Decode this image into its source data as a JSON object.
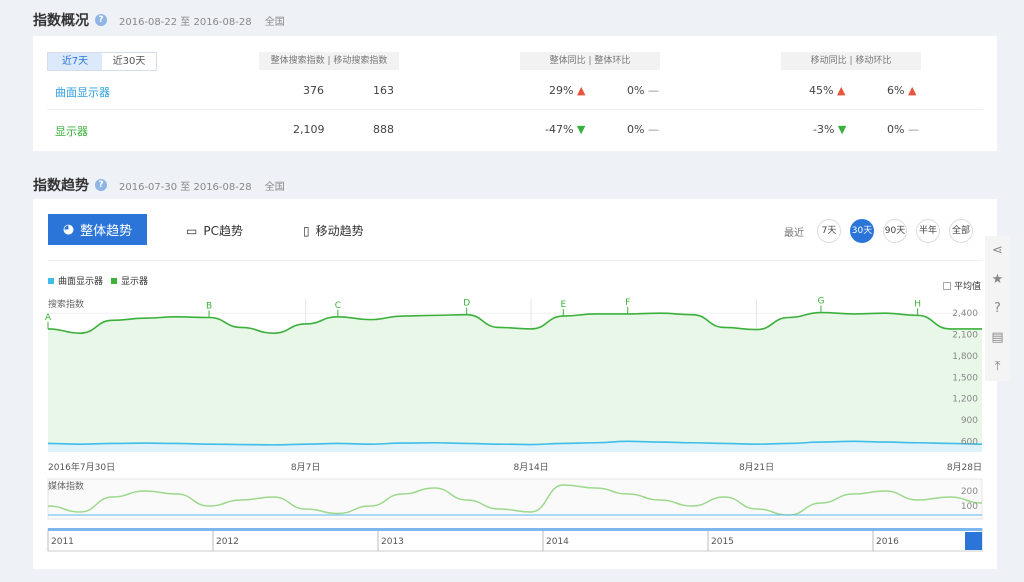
{
  "overview": {
    "title": "指数概况",
    "help": "?",
    "date_range": "2016-08-22 至 2016-08-28",
    "region": "全国",
    "tabs": [
      "近7天",
      "近30天"
    ],
    "headers": {
      "search": "整体搜索指数 | 移动搜索指数",
      "overall": "整体同比 | 整体环比",
      "mobile": "移动同比 | 移动环比"
    },
    "rows": [
      {
        "keyword": "曲面显示器",
        "total": "376",
        "mobile": "163",
        "overall_yoy": "29%",
        "overall_mom": "0%",
        "mobile_yoy": "45%",
        "mobile_mom": "6%"
      },
      {
        "keyword": "显示器",
        "total": "2,109",
        "mobile": "888",
        "overall_yoy": "-47%",
        "overall_mom": "0%",
        "mobile_yoy": "-3%",
        "mobile_mom": "0%"
      }
    ]
  },
  "trend": {
    "title": "指数趋势",
    "help": "?",
    "date_range": "2016-07-30 至 2016-08-28",
    "region": "全国",
    "tabs": [
      "整体趋势",
      "PC趋势",
      "移动趋势"
    ],
    "period_label": "最近",
    "periods": [
      "7天",
      "30天",
      "90天",
      "半年",
      "全部"
    ],
    "legend": [
      "曲面显示器",
      "显示器"
    ],
    "avg_label": "平均值",
    "search_label": "搜索指数",
    "media_label": "媒体指数",
    "y_ticks": [
      "2,400",
      "2,100",
      "1,800",
      "1,500",
      "1,200",
      "900",
      "600"
    ],
    "media_ticks": [
      "200",
      "100"
    ],
    "x_labels": [
      "2016年7月30日",
      "8月7日",
      "8月14日",
      "8月21日",
      "8月28日"
    ],
    "events": [
      "A",
      "B",
      "C",
      "D",
      "E",
      "F",
      "G",
      "H"
    ],
    "years": [
      "2011",
      "2012",
      "2013",
      "2014",
      "2015",
      "2016"
    ],
    "colors": {
      "kw1": "#3dbde8",
      "kw2": "#3bb03b"
    }
  },
  "chart_data": {
    "type": "line",
    "x": [
      "7/30",
      "7/31",
      "8/1",
      "8/2",
      "8/3",
      "8/4",
      "8/5",
      "8/6",
      "8/7",
      "8/8",
      "8/9",
      "8/10",
      "8/11",
      "8/12",
      "8/13",
      "8/14",
      "8/15",
      "8/16",
      "8/17",
      "8/18",
      "8/19",
      "8/20",
      "8/21",
      "8/22",
      "8/23",
      "8/24",
      "8/25",
      "8/26",
      "8/27",
      "8/28"
    ],
    "series": [
      {
        "name": "显示器",
        "values": [
          2180,
          2120,
          2300,
          2330,
          2350,
          2340,
          2200,
          2120,
          2250,
          2350,
          2310,
          2360,
          2370,
          2380,
          2200,
          2180,
          2360,
          2390,
          2390,
          2400,
          2380,
          2200,
          2170,
          2340,
          2410,
          2390,
          2400,
          2370,
          2180,
          2180
        ]
      },
      {
        "name": "曲面显示器",
        "values": [
          570,
          560,
          570,
          575,
          570,
          560,
          555,
          550,
          560,
          570,
          560,
          575,
          580,
          570,
          560,
          555,
          570,
          580,
          600,
          590,
          580,
          570,
          560,
          570,
          590,
          600,
          590,
          580,
          570,
          560
        ]
      }
    ],
    "ylim": [
      450,
      2600
    ],
    "ylabel": "搜索指数"
  }
}
